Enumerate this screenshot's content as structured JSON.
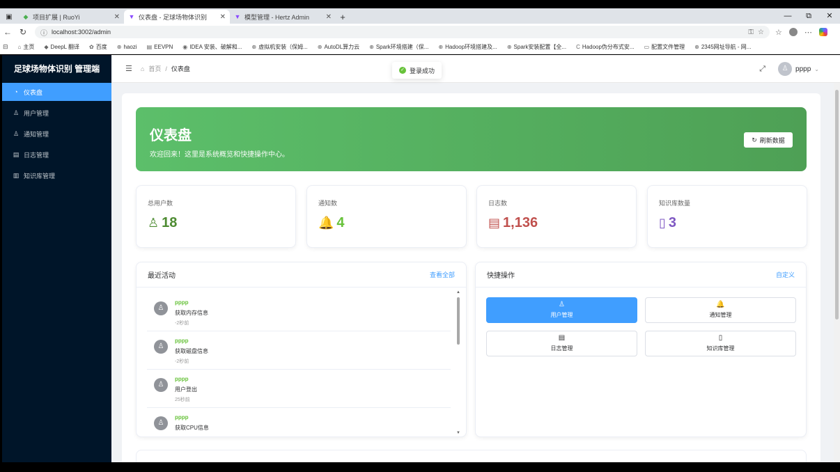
{
  "browser": {
    "tabs": [
      {
        "title": "项目扩展 | RuoYi",
        "icon": "ruoyi-icon",
        "color": "#4caf50",
        "glyph": "◆"
      },
      {
        "title": "仪表盘 - 足球场物体识别",
        "icon": "vite-icon",
        "color": "#8a4bff",
        "glyph": "▼"
      },
      {
        "title": "模型管理 - Hertz Admin",
        "icon": "vite-icon",
        "color": "#8a4bff",
        "glyph": "▼"
      }
    ],
    "url": "localhost:3002/admin",
    "bookmarks": [
      {
        "label": "主页",
        "icon": "home-icon",
        "glyph": "⌂"
      },
      {
        "label": "DeepL 翻译",
        "icon": "deepl-icon",
        "glyph": "◆"
      },
      {
        "label": "百度",
        "icon": "baidu-icon",
        "glyph": "✿"
      },
      {
        "label": "haozi",
        "icon": "globe-icon",
        "glyph": "⊕"
      },
      {
        "label": "EEVPN",
        "icon": "doc-icon",
        "glyph": "▤"
      },
      {
        "label": "IDEA 安装、破解和...",
        "icon": "idea-icon",
        "glyph": "◉"
      },
      {
        "label": "虚拟机安装（保姆...",
        "icon": "globe-icon",
        "glyph": "⊕"
      },
      {
        "label": "AutoDL算力云",
        "icon": "globe-icon",
        "glyph": "⊕"
      },
      {
        "label": "Spark环境搭建（保...",
        "icon": "globe-icon",
        "glyph": "⊕"
      },
      {
        "label": "Hadoop环境搭建及...",
        "icon": "globe-icon",
        "glyph": "⊕"
      },
      {
        "label": "Spark安装配置【全...",
        "icon": "globe-icon",
        "glyph": "⊕"
      },
      {
        "label": "Hadoop伪分布式安...",
        "icon": "csdn-icon",
        "glyph": "C"
      },
      {
        "label": "配置文件管理",
        "icon": "folder-icon",
        "glyph": "▭"
      },
      {
        "label": "2345网址导航 - 网...",
        "icon": "globe-icon",
        "glyph": "⊕"
      }
    ]
  },
  "sidebar": {
    "brand": "足球场物体识别 管理端",
    "items": [
      {
        "label": "仪表盘",
        "icon": "dashboard-icon",
        "glyph": "◔",
        "active": true
      },
      {
        "label": "用户管理",
        "icon": "user-icon",
        "glyph": "♙",
        "active": false
      },
      {
        "label": "通知管理",
        "icon": "user-icon",
        "glyph": "♙",
        "active": false
      },
      {
        "label": "日志管理",
        "icon": "log-icon",
        "glyph": "▤",
        "active": false
      },
      {
        "label": "知识库管理",
        "icon": "book-icon",
        "glyph": "▥",
        "active": false
      }
    ]
  },
  "header": {
    "breadcrumb_home": "首页",
    "breadcrumb_sep": "/",
    "breadcrumb_current": "仪表盘",
    "username": "pppp"
  },
  "toast": {
    "text": "登录成功"
  },
  "banner": {
    "title": "仪表盘",
    "subtitle": "欢迎回来！这里是系统概览和快捷操作中心。",
    "refresh_label": "刷新数据"
  },
  "stats": [
    {
      "label": "总用户数",
      "value": "18",
      "icon": "user-icon",
      "glyph": "♙",
      "color": "#4d8b31"
    },
    {
      "label": "通知数",
      "value": "4",
      "icon": "bell-icon",
      "glyph": "🔔",
      "color": "#67c23a"
    },
    {
      "label": "日志数",
      "value": "1,136",
      "icon": "log-search-icon",
      "glyph": "▤",
      "color": "#c0504d"
    },
    {
      "label": "知识库数量",
      "value": "3",
      "icon": "book-icon",
      "glyph": "▯",
      "color": "#7e57c2"
    }
  ],
  "activity": {
    "title": "最近活动",
    "view_all": "查看全部",
    "items": [
      {
        "user": "pppp",
        "action": "获取内存信息",
        "time": "-2秒前"
      },
      {
        "user": "pppp",
        "action": "获取磁盘信息",
        "time": "-2秒前"
      },
      {
        "user": "pppp",
        "action": "用户登出",
        "time": "25秒前"
      },
      {
        "user": "pppp",
        "action": "获取CPU信息",
        "time": ""
      }
    ]
  },
  "quick_actions": {
    "title": "快捷操作",
    "customize": "自定义",
    "buttons": [
      {
        "label": "用户管理",
        "icon": "user-icon",
        "glyph": "♙",
        "primary": true
      },
      {
        "label": "通知管理",
        "icon": "bell-icon",
        "glyph": "🔔",
        "primary": false
      },
      {
        "label": "日志管理",
        "icon": "log-icon",
        "glyph": "▤",
        "primary": false
      },
      {
        "label": "知识库管理",
        "icon": "book-icon",
        "glyph": "▯",
        "primary": false
      }
    ]
  },
  "colors": {
    "sidebar_bg": "#001529",
    "accent": "#409eff",
    "banner": "#5cbf6a"
  }
}
